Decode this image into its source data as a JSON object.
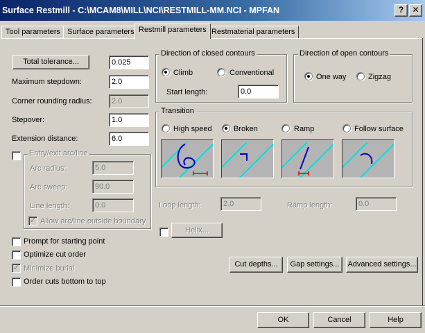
{
  "window": {
    "title": "Surface Restmill - C:\\MCAM8\\MILL\\NCI\\RESTMILL-MM.NCI - MPFAN",
    "help_glyph": "?",
    "close_glyph": "✕"
  },
  "tabs": [
    {
      "label": "Tool parameters"
    },
    {
      "label": "Surface parameters"
    },
    {
      "label": "Restmill parameters"
    },
    {
      "label": "Restmaterial parameters"
    }
  ],
  "left": {
    "total_tolerance_button": "Total tolerance...",
    "total_tolerance_value": "0.025",
    "max_stepdown_label": "Maximum stepdown:",
    "max_stepdown_value": "2.0",
    "corner_radius_label": "Corner rounding radius:",
    "corner_radius_value": "2.0",
    "stepover_label": "Stepover:",
    "stepover_value": "1.0",
    "extension_label": "Extension distance:",
    "extension_value": "6.0"
  },
  "entry_exit": {
    "title": "Entry/exit arc/line",
    "arc_radius_label": "Arc radius:",
    "arc_radius_value": "5.0",
    "arc_sweep_label": "Arc sweep:",
    "arc_sweep_value": "90.0",
    "line_length_label": "Line length:",
    "line_length_value": "0.0",
    "allow_outside_label": "Allow arc/line outside boundary",
    "check_mark": "✓"
  },
  "checkboxes": {
    "prompt_start": "Prompt for starting point",
    "optimize_cut": "Optimize cut order",
    "minimize_burial": "Minimize burial",
    "order_bottom_top": "Order cuts bottom to top",
    "check_mark": "✓"
  },
  "closed_contours": {
    "title": "Direction of closed contours",
    "climb_label": "Climb",
    "conventional_label": "Conventional",
    "start_length_label": "Start length:",
    "start_length_value": "0.0"
  },
  "open_contours": {
    "title": "Direction of open contours",
    "one_way_label": "One way",
    "zigzag_label": "Zigzag"
  },
  "transition": {
    "title": "Transition",
    "options": [
      "High speed",
      "Broken",
      "Ramp",
      "Follow surface"
    ],
    "selected": "Broken",
    "loop_length_label": "Loop length:",
    "loop_length_value": "2.0",
    "ramp_length_label": "Ramp length:",
    "ramp_length_value": "0.0",
    "helix_button": "Helix...",
    "colors": {
      "cut_path": "#0000c0",
      "surface_lines": "#00e0e0",
      "dimension": "#e00000"
    }
  },
  "action_buttons": {
    "cut_depths": "Cut depths...",
    "gap_settings": "Gap settings...",
    "advanced_settings": "Advanced settings..."
  },
  "footer": {
    "ok": "OK",
    "cancel": "Cancel",
    "help": "Help"
  }
}
